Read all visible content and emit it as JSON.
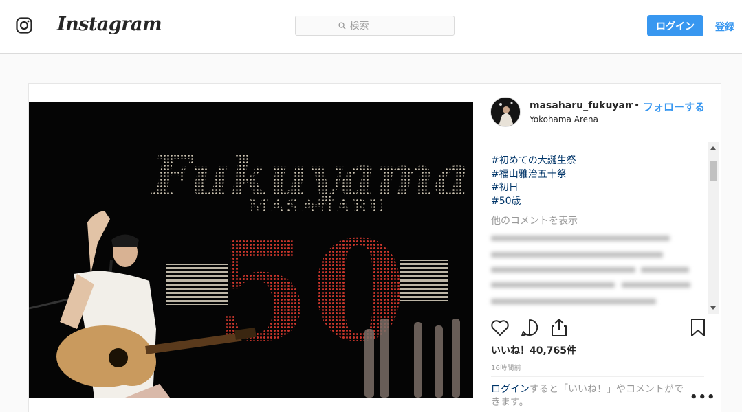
{
  "nav": {
    "brand_icon": "instagram-glyph-icon",
    "wordmark": "Instagram",
    "search_placeholder": "検索",
    "search_icon": "search-icon",
    "login_label": "ログイン",
    "register_label": "登録",
    "accent": "#3897f0"
  },
  "post": {
    "username": "masaharu_fukuyama_c",
    "separator": "•",
    "follow_label": "フォローする",
    "location": "Yokohama Arena",
    "hashtags": [
      "#初めての大誕生祭",
      "#福山雅治五十祭",
      "#初日",
      "#50歳"
    ],
    "show_comments_label": "他のコメントを表示",
    "likes_label": "いいね！40,765件",
    "time_ago": "16時間前",
    "login_prompt_link": "ログイン",
    "login_prompt_rest": "すると「いいね！」やコメントができます。",
    "more_label": "•••",
    "photo": {
      "sign_top": "Fukuyama",
      "sign_middle": "MASAHARU",
      "sign_number": "50"
    },
    "icons": [
      "heart-icon",
      "comment-icon",
      "share-icon",
      "bookmark-icon",
      "more-options-icon"
    ]
  }
}
